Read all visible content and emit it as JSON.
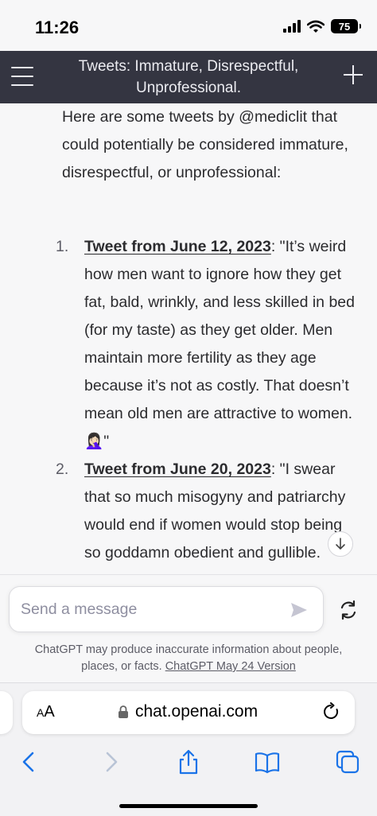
{
  "status_bar": {
    "time": "11:26",
    "battery": "75"
  },
  "header": {
    "title": "Tweets: Immature, Disrespectful, Unprofessional."
  },
  "message": {
    "intro": "Here are some tweets by @mediclit that could potentially be considered immature, disrespectful, or unprofessional:",
    "tweets": [
      {
        "number": "1.",
        "link": "Tweet from June 12, 2023",
        "text": ": \"It’s weird how men want to ignore how they get fat, bald, wrinkly, and less skilled in bed (for my taste) as they get older. Men maintain more fertility as they age because it’s not as costly. That doesn’t mean old men are attractive to women. 🤦🏻‍♀️\""
      },
      {
        "number": "2.",
        "link": "Tweet from June 20, 2023",
        "text": ": \"I swear that so much misogyny and patriarchy would end if women would stop being so goddamn obedient and gullible."
      }
    ]
  },
  "composer": {
    "placeholder": "Send a message",
    "disclaimer_text": "ChatGPT may produce inaccurate information about people, places, or facts.",
    "version_link": "ChatGPT May 24 Version"
  },
  "browser": {
    "aa_label_small": "A",
    "aa_label_large": "A",
    "url": "chat.openai.com"
  },
  "colors": {
    "header_bg": "#343541",
    "page_bg": "#f7f7f8",
    "text": "#2b2b2e"
  }
}
